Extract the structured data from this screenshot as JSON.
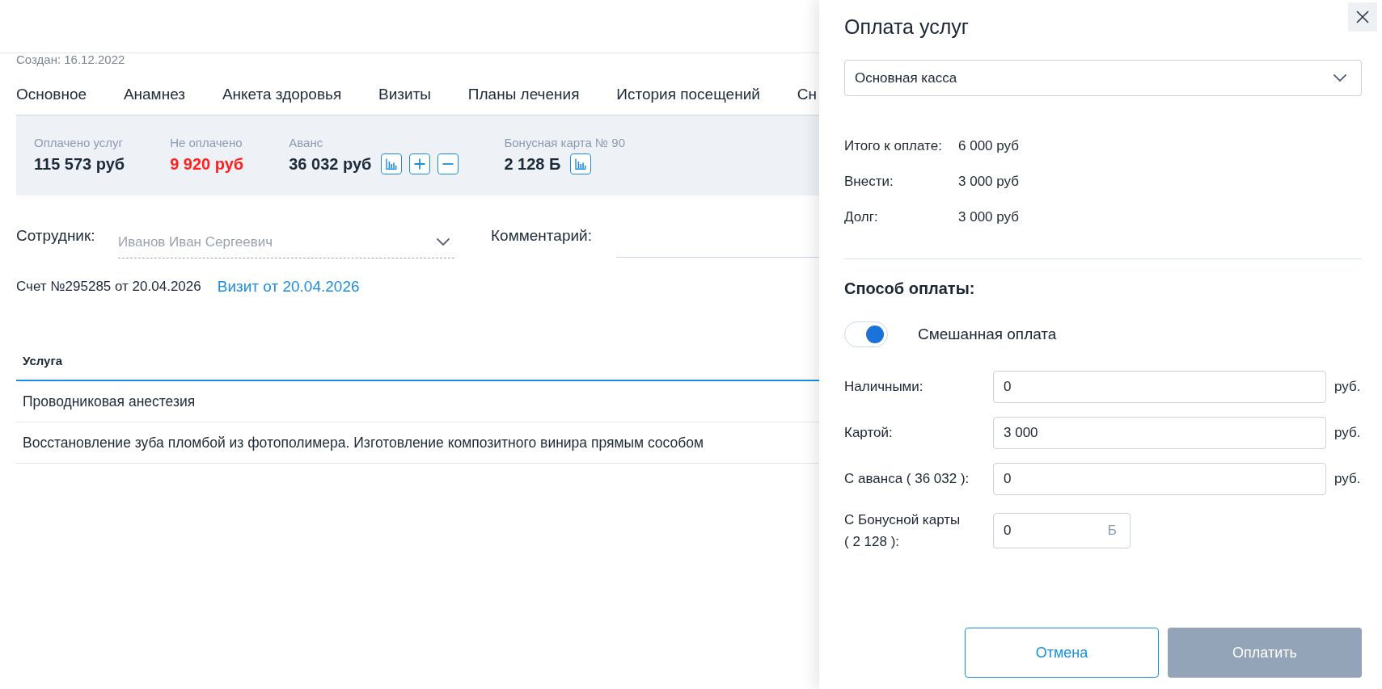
{
  "header": {
    "created": "Создан: 16.12.2022"
  },
  "tabs": [
    {
      "label": "Основное",
      "selected": false
    },
    {
      "label": "Анамнез",
      "selected": false
    },
    {
      "label": "Анкета здоровья",
      "selected": false
    },
    {
      "label": "Визиты",
      "selected": false
    },
    {
      "label": "Планы лечения",
      "selected": false
    },
    {
      "label": "История посещений",
      "selected": false
    },
    {
      "label": "Сн",
      "selected": false
    }
  ],
  "balance": [
    {
      "label": "Оплачено услуг",
      "value": "115 573 руб",
      "kind": "amount"
    },
    {
      "label": "Не оплачено",
      "value": "9 920 руб",
      "kind": "debt"
    },
    {
      "label": "Аванс",
      "value": "36 032 руб",
      "kind": "advance"
    },
    {
      "label": "Бонусная карта № 90",
      "value": "2 128 Б",
      "kind": "bonus"
    }
  ],
  "employee": {
    "label": "Сотрудник:",
    "value": "Иванов Иван Сергеевич",
    "disabled": true
  },
  "comment": {
    "label": "Комментарий:"
  },
  "invoice": {
    "text": "Счет №295285 от 20.04.2026",
    "visit_link": "Визит от 20.04.2026"
  },
  "table": {
    "columns": [
      "Услуга"
    ],
    "rows": [
      [
        "Проводниковая анестезия"
      ],
      [
        "Восстановление зуба пломбой из фотополимера. Изготовление композитного винира прямым сособом"
      ]
    ]
  },
  "payment": {
    "title": "Оплата услуг",
    "cashbox": "Основная касса",
    "totals": [
      {
        "label": "Итого к оплате:",
        "value": "6 000 руб"
      },
      {
        "label": "Внести:",
        "value": "3 000 руб"
      },
      {
        "label": "Долг:",
        "value": "3 000 руб"
      }
    ],
    "method_heading": "Способ оплаты:",
    "mixed": {
      "label": "Смешанная оплата",
      "on": true
    },
    "fields": [
      {
        "label": "Наличными:",
        "value": "0",
        "unit": "руб.",
        "kind": "money"
      },
      {
        "label": "Картой:",
        "value": "3 000",
        "unit": "руб.",
        "kind": "money"
      },
      {
        "label": "С аванса ( 36 032 ):",
        "value": "0",
        "unit": "руб.",
        "kind": "money"
      },
      {
        "label": "С Бонусной карты ( 2 128 ):",
        "value": "0",
        "suffix": "Б",
        "kind": "bonus"
      }
    ],
    "buttons": [
      {
        "label": "Отмена",
        "kind": "secondary",
        "disabled": false
      },
      {
        "label": "Оплатить",
        "kind": "primary",
        "disabled": true
      }
    ]
  }
}
